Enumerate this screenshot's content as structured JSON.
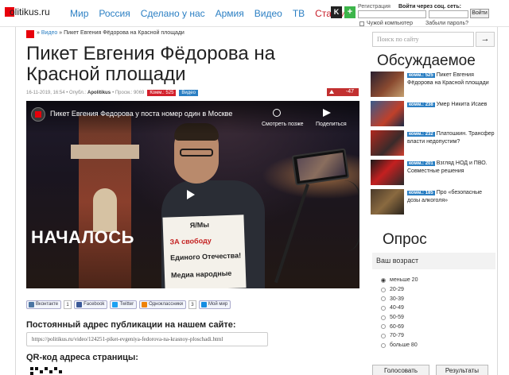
{
  "header": {
    "logo": "olitikus.ru",
    "nav": [
      "Мир",
      "Россия",
      "Сделано у нас",
      "Армия",
      "Видео",
      "ТВ",
      "Статьи"
    ],
    "social_k": "K",
    "social_plus": "+",
    "register": "Регистрация",
    "login_via": "Войти через соц. сеть:",
    "login_button": "Войти",
    "remember_label": "Чужой компьютер",
    "forgot": "Забыли пароль?"
  },
  "breadcrumb": {
    "separator": "»",
    "section": "Видео",
    "current": "Пикет Евгения Фёдорова на Красной площади"
  },
  "article": {
    "title": "Пикет Евгения Фёдорова на Красной площади",
    "date": "16-11-2019, 16:54",
    "published_prefix": "Опубл.:",
    "author": "Apolitikus",
    "views": "Просм.: 9069",
    "comments": "Комм.: 525",
    "category": "Видео",
    "rating": "-47"
  },
  "video": {
    "title": "Пикет Евгения Федорова у поста номер один в Москве",
    "watch_later": "Смотреть позже",
    "share": "Поделиться",
    "overlay_text": "НАЧАЛОСЬ",
    "sign_lines": [
      "Я/Мы",
      "ЗА свободу",
      "Единого Отечества!",
      "Медиа народные"
    ]
  },
  "share_buttons": [
    {
      "label": "Вконтакте",
      "count": "1",
      "color": "#4c75a3"
    },
    {
      "label": "Facebook",
      "count": "",
      "color": "#3b5998"
    },
    {
      "label": "Twitter",
      "count": "",
      "color": "#1da1f2"
    },
    {
      "label": "Одноклассники",
      "count": "3",
      "color": "#ee8208"
    },
    {
      "label": "Мой мир",
      "count": "",
      "color": "#168de2"
    }
  ],
  "permalink": {
    "label": "Постоянный адрес публикации на нашем сайте:",
    "url": "https://politikus.ru/video/124251-piket-evgeniya-fedorova-na-krasnoy-ploschadi.html"
  },
  "qr_label": "QR-код адреса страницы:",
  "sidebar": {
    "search_placeholder": "Поиск по сайту",
    "search_button": "→",
    "discussed_title": "Обсуждаемое",
    "discussed": [
      {
        "comments": "комм.: 525",
        "text": "Пикет Евгения Фёдорова на Красной площади"
      },
      {
        "comments": "комм.: 238",
        "text": "Умер Никита Исаев"
      },
      {
        "comments": "комм.: 232",
        "text": "Платошкин. Трансфер власти недопустим?"
      },
      {
        "comments": "комм.: 201",
        "text": "Взгляд НОД и ПВО. Совместные решения"
      },
      {
        "comments": "комм.: 185",
        "text": "Про «безопасные дозы алкоголя»"
      }
    ],
    "poll_title": "Опрос",
    "poll_question": "Ваш возраст",
    "poll_options": [
      "меньше 20",
      "20-29",
      "30-39",
      "40-49",
      "50-59",
      "60-69",
      "70-79",
      "больше 80"
    ],
    "vote_button": "Голосовать",
    "results_button": "Результаты"
  },
  "colors": {
    "brand_red": "#e8000b",
    "link_blue": "#2b7fc3",
    "comment_red": "#d3202b"
  }
}
